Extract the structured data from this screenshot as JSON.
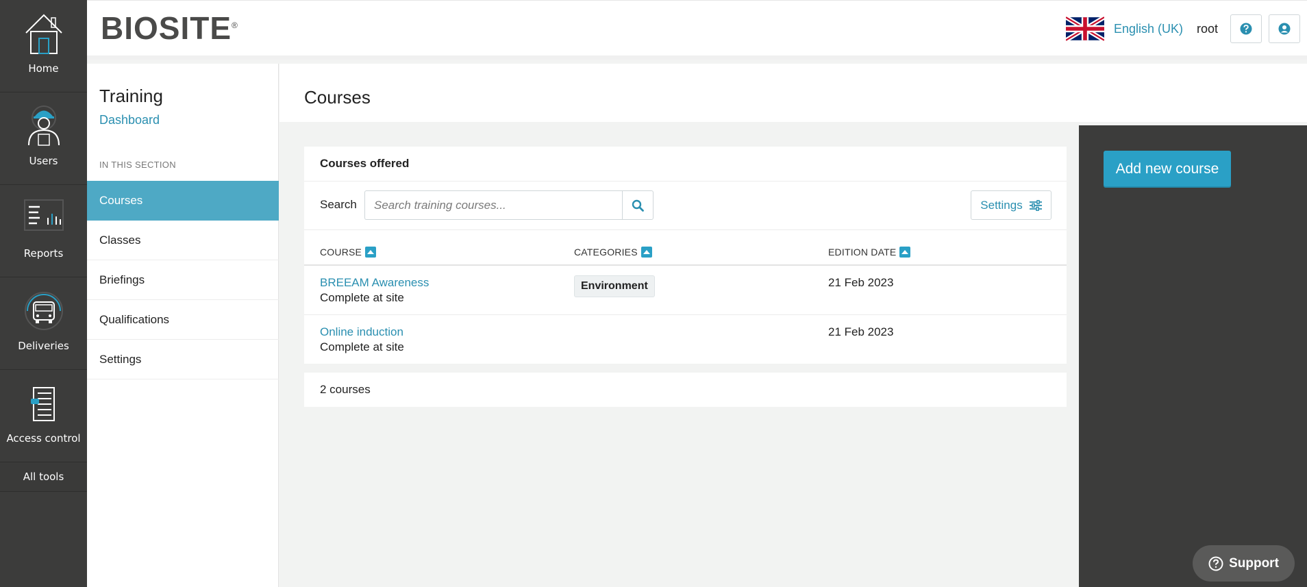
{
  "rail": {
    "items": [
      {
        "label": "Home",
        "icon": "home-icon"
      },
      {
        "label": "Users",
        "icon": "worker-icon"
      },
      {
        "label": "Reports",
        "icon": "reports-icon"
      },
      {
        "label": "Deliveries",
        "icon": "truck-icon"
      },
      {
        "label": "Access control",
        "icon": "turnstile-icon"
      }
    ],
    "all_tools": "All tools"
  },
  "header": {
    "logo": "BIOSITE",
    "logo_mark": "®",
    "language": "English (UK)",
    "user": "root"
  },
  "subnav": {
    "title": "Training",
    "dashboard": "Dashboard",
    "section_label": "IN THIS SECTION",
    "items": [
      {
        "label": "Courses",
        "active": true
      },
      {
        "label": "Classes"
      },
      {
        "label": "Briefings"
      },
      {
        "label": "Qualifications"
      },
      {
        "label": "Settings"
      }
    ]
  },
  "main": {
    "page_title": "Courses",
    "card_title": "Courses offered",
    "search_label": "Search",
    "search_placeholder": "Search training courses...",
    "settings_label": "Settings",
    "columns": [
      "COURSE",
      "CATEGORIES",
      "EDITION DATE"
    ],
    "rows": [
      {
        "course": "BREEAM Awareness",
        "subtitle": "Complete at site",
        "category": "Environment",
        "edition_date": "21 Feb 2023"
      },
      {
        "course": "Online induction",
        "subtitle": "Complete at site",
        "category": "",
        "edition_date": "21 Feb 2023"
      }
    ],
    "count": "2 courses"
  },
  "actions": {
    "add_course": "Add new course"
  },
  "support": {
    "label": "Support"
  },
  "colors": {
    "accent": "#2aa0c6",
    "link": "#2a8fb0",
    "active_nav": "#4ea9c5",
    "rail_bg": "#3c3c3b"
  }
}
